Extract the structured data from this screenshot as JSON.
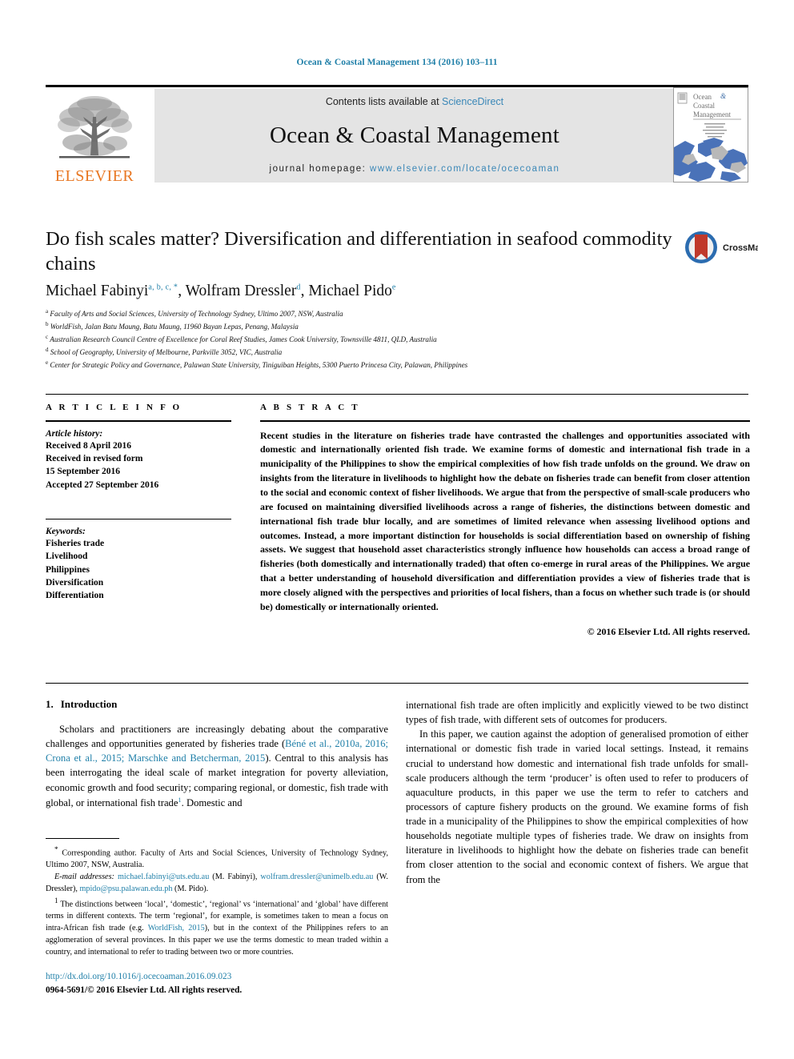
{
  "running_head": "Ocean & Coastal Management 134 (2016) 103–111",
  "masthead": {
    "publisher_name": "ELSEVIER",
    "contents_prefix": "Contents lists available at ",
    "contents_link": "ScienceDirect",
    "journal_title": "Ocean & Coastal Management",
    "homepage_prefix": "journal homepage: ",
    "homepage_url": "www.elsevier.com/locate/ocecoaman",
    "cover_title_line1": "Ocean &",
    "cover_title_line2": "Coastal",
    "cover_title_line3": "Management"
  },
  "crossmark": {
    "label": "CrossMark"
  },
  "article": {
    "title": "Do fish scales matter? Diversification and differentiation in seafood commodity chains",
    "authors": [
      {
        "name": "Michael Fabinyi",
        "marks": "a, b, c, *"
      },
      {
        "name": "Wolfram Dressler",
        "marks": "d"
      },
      {
        "name": "Michael Pido",
        "marks": "e"
      }
    ],
    "author_separator": ", ",
    "affiliations": [
      {
        "mark": "a",
        "text": "Faculty of Arts and Social Sciences, University of Technology Sydney, Ultimo 2007, NSW, Australia"
      },
      {
        "mark": "b",
        "text": "WorldFish, Jalan Batu Maung, Batu Maung, 11960 Bayan Lepas, Penang, Malaysia"
      },
      {
        "mark": "c",
        "text": "Australian Research Council Centre of Excellence for Coral Reef Studies, James Cook University, Townsville 4811, QLD, Australia"
      },
      {
        "mark": "d",
        "text": "School of Geography, University of Melbourne, Parkville 3052, VIC, Australia"
      },
      {
        "mark": "e",
        "text": "Center for Strategic Policy and Governance, Palawan State University, Tiniguiban Heights, 5300 Puerto Princesa City, Palawan, Philippines"
      }
    ]
  },
  "article_info": {
    "heading": "A R T I C L E   I N F O",
    "history_label": "Article history:",
    "history_lines": [
      "Received 8 April 2016",
      "Received in revised form",
      "15 September 2016",
      "Accepted 27 September 2016"
    ],
    "keywords_label": "Keywords:",
    "keywords": [
      "Fisheries trade",
      "Livelihood",
      "Philippines",
      "Diversification",
      "Differentiation"
    ]
  },
  "abstract": {
    "heading": "A B S T R A C T",
    "text": "Recent studies in the literature on fisheries trade have contrasted the challenges and opportunities associated with domestic and internationally oriented fish trade. We examine forms of domestic and international fish trade in a municipality of the Philippines to show the empirical complexities of how fish trade unfolds on the ground. We draw on insights from the literature in livelihoods to highlight how the debate on fisheries trade can benefit from closer attention to the social and economic context of fisher livelihoods. We argue that from the perspective of small-scale producers who are focused on maintaining diversified livelihoods across a range of fisheries, the distinctions between domestic and international fish trade blur locally, and are sometimes of limited relevance when assessing livelihood options and outcomes. Instead, a more important distinction for households is social differentiation based on ownership of fishing assets. We suggest that household asset characteristics strongly influence how households can access a broad range of fisheries (both domestically and internationally traded) that often co-emerge in rural areas of the Philippines. We argue that a better understanding of household diversification and differentiation provides a view of fisheries trade that is more closely aligned with the perspectives and priorities of local fishers, than a focus on whether such trade is (or should be) domestically or internationally oriented.",
    "copyright": "© 2016 Elsevier Ltd. All rights reserved."
  },
  "introduction": {
    "number": "1.",
    "heading": "Introduction",
    "para1_a": "Scholars and practitioners are increasingly debating about the comparative challenges and opportunities generated by fisheries trade (",
    "para1_refs": "Béné et al., 2010a, 2016; Crona et al., 2015; Marschke and Betcherman, 2015",
    "para1_b": "). Central to this analysis has been interrogating the ideal scale of market integration for poverty alleviation, economic growth and food security; comparing regional, or domestic, fish trade with global, or international fish trade",
    "para1_footnote_mark": "1",
    "para1_c": ". Domestic and",
    "para2": "international fish trade are often implicitly and explicitly viewed to be two distinct types of fish trade, with different sets of outcomes for producers.",
    "para3": "In this paper, we caution against the adoption of generalised promotion of either international or domestic fish trade in varied local settings. Instead, it remains crucial to understand how domestic and international fish trade unfolds for small-scale producers although the term ‘producer’ is often used to refer to producers of aquaculture products, in this paper we use the term to refer to catchers and processors of capture fishery products on the ground. We examine forms of fish trade in a municipality of the Philippines to show the empirical complexities of how households negotiate multiple types of fisheries trade. We draw on insights from literature in livelihoods to highlight how the debate on fisheries trade can benefit from closer attention to the social and economic context of fishers. We argue that from the"
  },
  "footnotes": {
    "corresponding_mark": "*",
    "corresponding": "Corresponding author. Faculty of Arts and Social Sciences, University of Technology Sydney, Ultimo 2007, NSW, Australia.",
    "email_label": "E-mail addresses:",
    "emails": [
      {
        "address": "michael.fabinyi@uts.edu.au",
        "owner": " (M. Fabinyi), "
      },
      {
        "address": "wolfram.dressler@unimelb.edu.au",
        "owner": " (W. Dressler), "
      },
      {
        "address": "mpido@psu.palawan.edu.ph",
        "owner": " (M. Pido)."
      }
    ],
    "fn1_mark": "1",
    "fn1_a": "The distinctions between ‘local’, ‘domestic’, ‘regional’ vs ‘international’ and ‘global’ have different terms in different contexts. The term ‘regional’, for example, is sometimes taken to mean a focus on intra-African fish trade (e.g. ",
    "fn1_ref": "WorldFish, 2015",
    "fn1_b": "), but in the context of the Philippines refers to an agglomeration of several provinces. In this paper we use the terms domestic to mean traded within a country, and international to refer to trading between two or more countries."
  },
  "footer": {
    "doi": "http://dx.doi.org/10.1016/j.ocecoaman.2016.09.023",
    "issn": "0964-5691/© 2016 Elsevier Ltd. All rights reserved."
  },
  "colors": {
    "link": "#1f7fa8",
    "elsevier_orange": "#e87722",
    "band_gray": "#e4e4e4"
  }
}
